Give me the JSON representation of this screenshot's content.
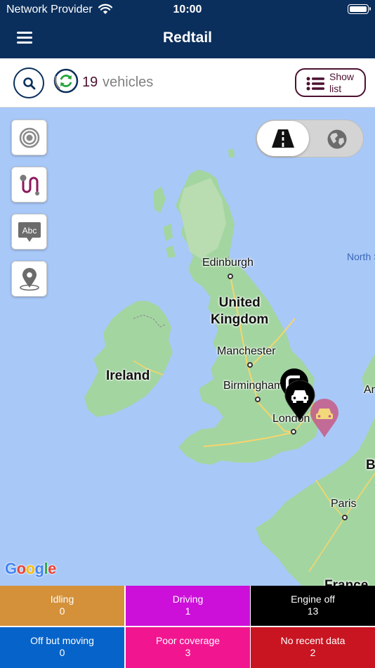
{
  "status_bar": {
    "carrier": "Network Provider",
    "time": "10:00"
  },
  "header": {
    "title": "Redtail"
  },
  "toolbar": {
    "vehicle_count": "19",
    "vehicle_label": "vehicles",
    "show_list_label": "Show list"
  },
  "map": {
    "labels": {
      "edinburgh": "Edinburgh",
      "united_kingdom": "United\nKingdom",
      "manchester": "Manchester",
      "birmingham": "Birmingham",
      "london": "London",
      "ireland": "Ireland",
      "paris": "Paris",
      "north_sea": "North S",
      "france_partial": "France",
      "amsterdam_partial": "Ar",
      "belgium_partial": "B"
    },
    "attribution": "Google",
    "map_type_selected": "road",
    "marker_colors": {
      "engine_off": "#000000",
      "poor_coverage": "#c75b86"
    }
  },
  "statuses": [
    {
      "label": "Idling",
      "count": "0",
      "color": "#d4913a"
    },
    {
      "label": "Driving",
      "count": "1",
      "color": "#cc0fd9"
    },
    {
      "label": "Engine off",
      "count": "13",
      "color": "#000000"
    },
    {
      "label": "Off but moving",
      "count": "0",
      "color": "#0663c9"
    },
    {
      "label": "Poor coverage",
      "count": "3",
      "color": "#f21590"
    },
    {
      "label": "No recent data",
      "count": "2",
      "color": "#c91521"
    }
  ],
  "icons": {
    "menu": "hamburger-icon",
    "search": "search-icon",
    "refresh": "refresh-icon",
    "list": "list-icon",
    "target": "target-icon",
    "route": "route-icon",
    "labels": "label-icon",
    "location": "location-pin-icon",
    "road": "road-icon",
    "globe": "globe-icon",
    "vehicle": "car-icon"
  }
}
